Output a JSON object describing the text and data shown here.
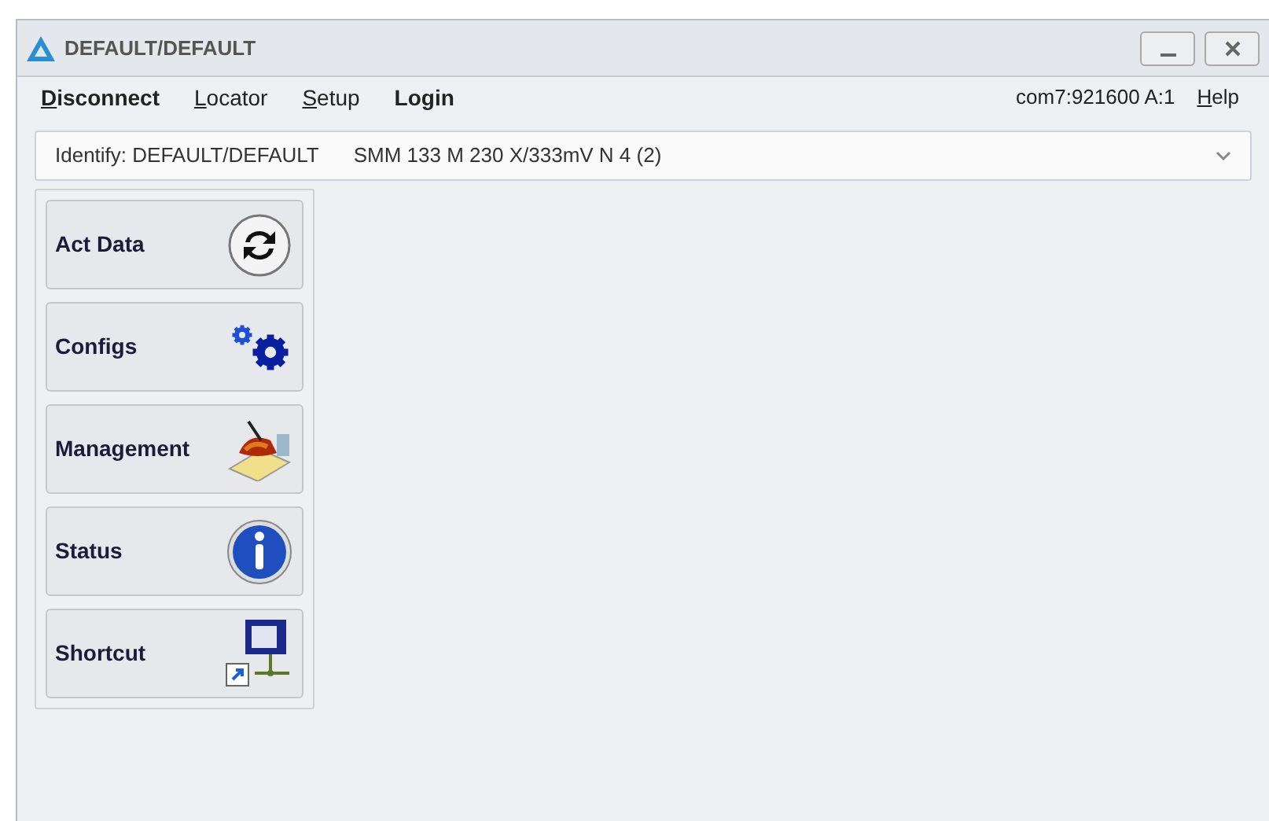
{
  "window": {
    "title": "DEFAULT/DEFAULT"
  },
  "menu": [
    {
      "mnemonic": "D",
      "rest": "isconnect",
      "bold": true
    },
    {
      "mnemonic": "L",
      "rest": "ocator",
      "bold": false
    },
    {
      "mnemonic": "S",
      "rest": "etup",
      "bold": false
    },
    {
      "rest": "Login",
      "bold": true
    }
  ],
  "connection": "com7:921600 A:1",
  "help": {
    "mnemonic": "H",
    "rest": "elp"
  },
  "identify": {
    "label": "Identify: DEFAULT/DEFAULT",
    "device": "SMM 133 M 230 X/333mV N 4 (2)"
  },
  "nav_buttons": [
    {
      "label": "Act Data",
      "kind": "refresh"
    },
    {
      "label": "Configs",
      "kind": "gears"
    },
    {
      "label": "Management",
      "kind": "management"
    },
    {
      "label": "Status",
      "kind": "info"
    },
    {
      "label": "Shortcut",
      "kind": "shortcut"
    }
  ]
}
